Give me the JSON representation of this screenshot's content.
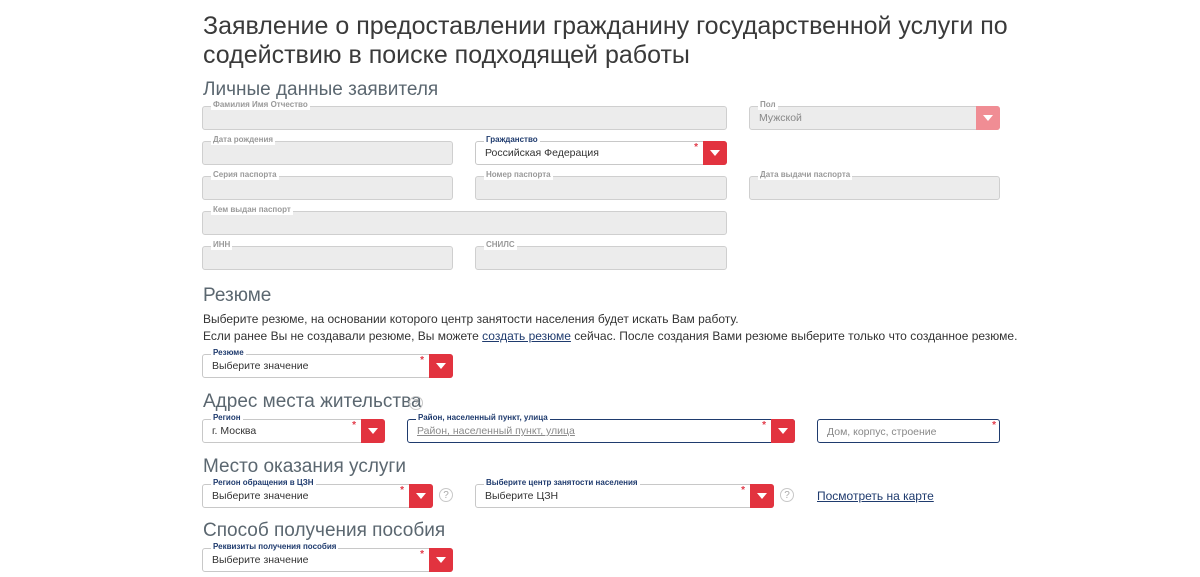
{
  "page_title": "Заявление о предоставлении гражданину государственной услуги по содействию в поиске подходящей работы",
  "personal": {
    "heading": "Личные данные заявителя",
    "full_name_label": "Фамилия Имя Отчество",
    "gender_label": "Пол",
    "gender_value": "Мужской",
    "birth_date_label": "Дата рождения",
    "citizenship_label": "Гражданство",
    "citizenship_value": "Российская Федерация",
    "passport_series_label": "Серия паспорта",
    "passport_number_label": "Номер паспорта",
    "passport_date_label": "Дата выдачи паспорта",
    "passport_issuer_label": "Кем выдан паспорт",
    "inn_label": "ИНН",
    "snils_label": "СНИЛС"
  },
  "resume": {
    "heading": "Резюме",
    "line1": "Выберите резюме, на основании которого центр занятости населения будет искать Вам работу.",
    "line2_before": "Если ранее Вы не создавали резюме, Вы можете ",
    "line2_link": "создать резюме",
    "line2_after": " сейчас. После создания Вами резюме выберите только что созданное резюме.",
    "select_label": "Резюме",
    "select_value": "Выберите значение"
  },
  "address": {
    "heading": "Адрес места жительства",
    "region_label": "Регион",
    "region_value": "г. Москва",
    "district_label": "Район, населенный пункт, улица",
    "district_placeholder": "Район, населенный пункт, улица",
    "house_placeholder": "Дом, корпус, строение"
  },
  "service_place": {
    "heading": "Место оказания услуги",
    "region_label": "Регион обращения в ЦЗН",
    "region_value": "Выберите значение",
    "center_label": "Выберите центр занятости населения",
    "center_value": "Выберите ЦЗН",
    "map_link": "Посмотреть на карте"
  },
  "benefit": {
    "heading": "Способ получения пособия",
    "details_label": "Реквизиты получения пособия",
    "details_value": "Выберите значение"
  },
  "help_glyph": "?",
  "required_mark": "*",
  "colors": {
    "accent_red": "#e2333f",
    "accent_red_disabled": "#f08d94",
    "label_blue": "#1f3b6e",
    "field_disabled_bg": "#ececec"
  }
}
